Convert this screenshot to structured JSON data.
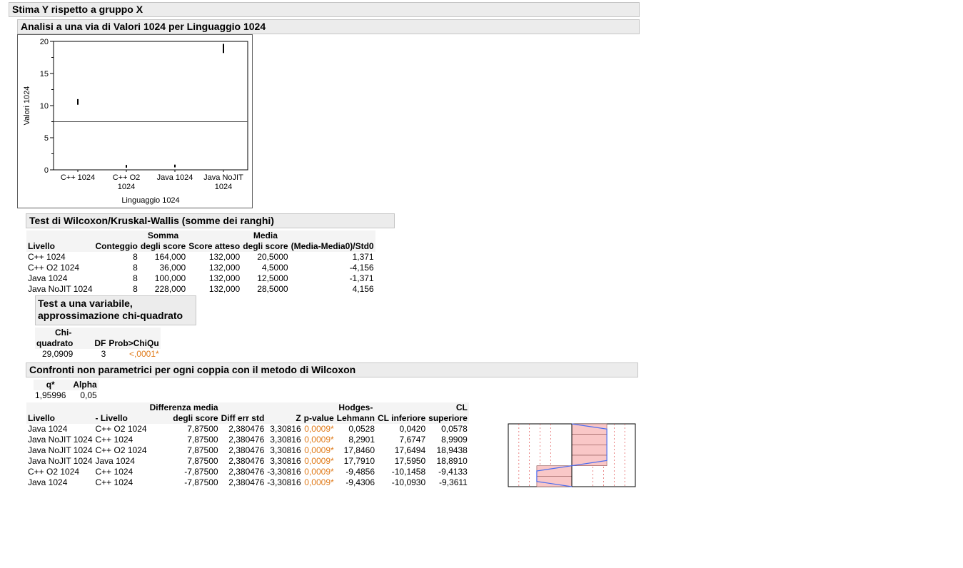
{
  "report": {
    "title": "Stima Y rispetto a gruppo X",
    "analysis_title": "Analisi a una via di Valori 1024 per Linguaggio 1024"
  },
  "chart_data": {
    "type": "scatter",
    "ylabel": "Valori 1024",
    "xlabel": "Linguaggio 1024",
    "ylim": [
      0,
      20
    ],
    "yticks": [
      0,
      5,
      10,
      15,
      20
    ],
    "categories": [
      "C++ 1024",
      "C++ O2 1024",
      "Java 1024",
      "Java NoJIT 1024"
    ],
    "category_labels": [
      [
        "C++ 1024"
      ],
      [
        "C++ O2",
        "1024"
      ],
      [
        "Java 1024"
      ],
      [
        "Java NoJIT",
        "1024"
      ]
    ],
    "points": [
      [
        10.25,
        10.35,
        10.45,
        10.5,
        10.6,
        10.7,
        10.8,
        10.9
      ],
      [
        0.45,
        0.5,
        0.52,
        0.55,
        0.57,
        0.6,
        0.62,
        0.65
      ],
      [
        0.5,
        0.55,
        0.57,
        0.6,
        0.62,
        0.65,
        0.67,
        0.7
      ],
      [
        18.3,
        18.5,
        18.7,
        18.9,
        19.0,
        19.2,
        19.3,
        19.5
      ]
    ],
    "reference_line": 7.5,
    "grid": false
  },
  "wilcoxon": {
    "title": "Test di Wilcoxon/Kruskal-Wallis (somme dei ranghi)",
    "headers": {
      "livello": "Livello",
      "conteggio": "Conteggio",
      "somma1": "Somma",
      "somma2": "degli score",
      "score_atteso": "Score atteso",
      "media1": "Media",
      "media2": "degli score",
      "std": "(Media-Media0)/Std0"
    },
    "rows": [
      {
        "livello": "C++ 1024",
        "conteggio": "8",
        "somma": "164,000",
        "atteso": "132,000",
        "media": "20,5000",
        "std": "1,371"
      },
      {
        "livello": "C++ O2 1024",
        "conteggio": "8",
        "somma": "36,000",
        "atteso": "132,000",
        "media": "4,5000",
        "std": "-4,156"
      },
      {
        "livello": "Java 1024",
        "conteggio": "8",
        "somma": "100,000",
        "atteso": "132,000",
        "media": "12,5000",
        "std": "-1,371"
      },
      {
        "livello": "Java NoJIT 1024",
        "conteggio": "8",
        "somma": "228,000",
        "atteso": "132,000",
        "media": "28,5000",
        "std": "4,156"
      }
    ]
  },
  "chisq": {
    "title_line1": "Test a una variabile,",
    "title_line2": "approssimazione chi-quadrato",
    "headers": {
      "chi1": "Chi-",
      "chi2": "quadrato",
      "df": "DF",
      "prob": "Prob>ChiQu"
    },
    "row": {
      "chi": "29,0909",
      "df": "3",
      "prob": "<,0001*"
    }
  },
  "pairwise": {
    "title": "Confronti non parametrici per ogni coppia con il metodo di Wilcoxon",
    "q_header": "q*",
    "alpha_header": "Alpha",
    "q_value": "1,95996",
    "alpha_value": "0,05",
    "headers": {
      "livello": "Livello",
      "meno_livello": "- Livello",
      "diff1": "Differenza media",
      "diff2": "degli score",
      "err": "Diff err std",
      "z": "Z",
      "p": "p-value",
      "hl1": "Hodges-",
      "hl2": "Lehmann",
      "cl_inf": "CL inferiore",
      "cl_sup1": "CL",
      "cl_sup2": "superiore"
    },
    "rows": [
      {
        "a": "Java 1024",
        "b": "C++ O2 1024",
        "diff": "7,87500",
        "err": "2,380476",
        "z": "3,30816",
        "p": "0,0009*",
        "hl": "0,0528",
        "lo": "0,0420",
        "hi": "0,0578"
      },
      {
        "a": "Java NoJIT 1024",
        "b": "C++ 1024",
        "diff": "7,87500",
        "err": "2,380476",
        "z": "3,30816",
        "p": "0,0009*",
        "hl": "8,2901",
        "lo": "7,6747",
        "hi": "8,9909"
      },
      {
        "a": "Java NoJIT 1024",
        "b": "C++ O2 1024",
        "diff": "7,87500",
        "err": "2,380476",
        "z": "3,30816",
        "p": "0,0009*",
        "hl": "17,8460",
        "lo": "17,6494",
        "hi": "18,9438"
      },
      {
        "a": "Java NoJIT 1024",
        "b": "Java 1024",
        "diff": "7,87500",
        "err": "2,380476",
        "z": "3,30816",
        "p": "0,0009*",
        "hl": "17,7910",
        "lo": "17,5950",
        "hi": "18,8910"
      },
      {
        "a": "C++ O2 1024",
        "b": "C++ 1024",
        "diff": "-7,87500",
        "err": "2,380476",
        "z": "-3,30816",
        "p": "0,0009*",
        "hl": "-9,4856",
        "lo": "-10,1458",
        "hi": "-9,4133"
      },
      {
        "a": "Java 1024",
        "b": "C++ 1024",
        "diff": "-7,87500",
        "err": "2,380476",
        "z": "-3,30816",
        "p": "0,0009*",
        "hl": "-9,4306",
        "lo": "-10,0930",
        "hi": "-9,3611"
      }
    ],
    "bar_chart": {
      "type": "bar",
      "values": [
        3.30816,
        3.30816,
        3.30816,
        3.30816,
        -3.30816,
        -3.30816
      ],
      "xlim": [
        -6,
        6
      ],
      "dashed_lines": [
        -5,
        -4,
        -3,
        -2,
        2,
        3,
        4,
        5
      ],
      "bar_fill": "#f9c7c7",
      "bar_stroke": "#8b5050",
      "curve_color": "#4a6cf0",
      "grid_color": "#e05050"
    }
  }
}
